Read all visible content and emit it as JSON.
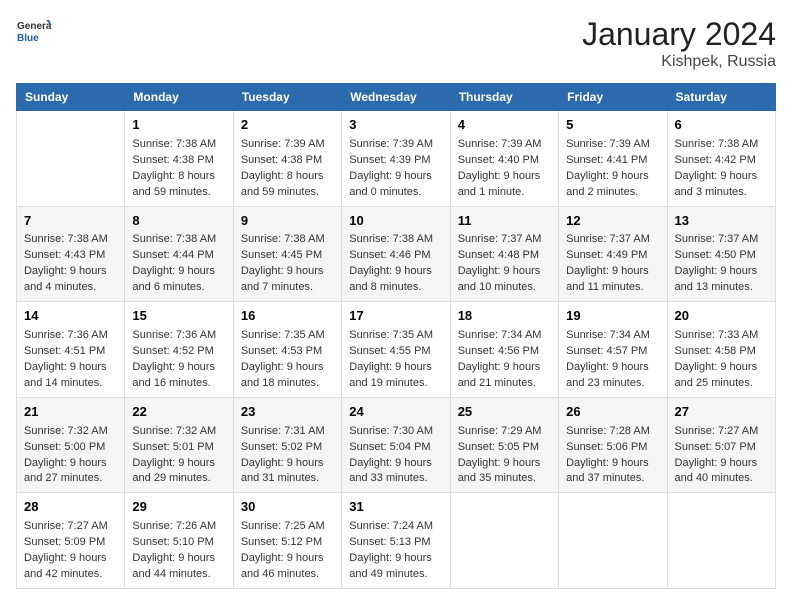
{
  "logo": {
    "general": "General",
    "blue": "Blue"
  },
  "title": "January 2024",
  "subtitle": "Kishpek, Russia",
  "days_header": [
    "Sunday",
    "Monday",
    "Tuesday",
    "Wednesday",
    "Thursday",
    "Friday",
    "Saturday"
  ],
  "weeks": [
    [
      {
        "day": "",
        "content": ""
      },
      {
        "day": "1",
        "content": "Sunrise: 7:38 AM\nSunset: 4:38 PM\nDaylight: 8 hours\nand 59 minutes."
      },
      {
        "day": "2",
        "content": "Sunrise: 7:39 AM\nSunset: 4:38 PM\nDaylight: 8 hours\nand 59 minutes."
      },
      {
        "day": "3",
        "content": "Sunrise: 7:39 AM\nSunset: 4:39 PM\nDaylight: 9 hours\nand 0 minutes."
      },
      {
        "day": "4",
        "content": "Sunrise: 7:39 AM\nSunset: 4:40 PM\nDaylight: 9 hours\nand 1 minute."
      },
      {
        "day": "5",
        "content": "Sunrise: 7:39 AM\nSunset: 4:41 PM\nDaylight: 9 hours\nand 2 minutes."
      },
      {
        "day": "6",
        "content": "Sunrise: 7:38 AM\nSunset: 4:42 PM\nDaylight: 9 hours\nand 3 minutes."
      }
    ],
    [
      {
        "day": "7",
        "content": "Sunrise: 7:38 AM\nSunset: 4:43 PM\nDaylight: 9 hours\nand 4 minutes."
      },
      {
        "day": "8",
        "content": "Sunrise: 7:38 AM\nSunset: 4:44 PM\nDaylight: 9 hours\nand 6 minutes."
      },
      {
        "day": "9",
        "content": "Sunrise: 7:38 AM\nSunset: 4:45 PM\nDaylight: 9 hours\nand 7 minutes."
      },
      {
        "day": "10",
        "content": "Sunrise: 7:38 AM\nSunset: 4:46 PM\nDaylight: 9 hours\nand 8 minutes."
      },
      {
        "day": "11",
        "content": "Sunrise: 7:37 AM\nSunset: 4:48 PM\nDaylight: 9 hours\nand 10 minutes."
      },
      {
        "day": "12",
        "content": "Sunrise: 7:37 AM\nSunset: 4:49 PM\nDaylight: 9 hours\nand 11 minutes."
      },
      {
        "day": "13",
        "content": "Sunrise: 7:37 AM\nSunset: 4:50 PM\nDaylight: 9 hours\nand 13 minutes."
      }
    ],
    [
      {
        "day": "14",
        "content": "Sunrise: 7:36 AM\nSunset: 4:51 PM\nDaylight: 9 hours\nand 14 minutes."
      },
      {
        "day": "15",
        "content": "Sunrise: 7:36 AM\nSunset: 4:52 PM\nDaylight: 9 hours\nand 16 minutes."
      },
      {
        "day": "16",
        "content": "Sunrise: 7:35 AM\nSunset: 4:53 PM\nDaylight: 9 hours\nand 18 minutes."
      },
      {
        "day": "17",
        "content": "Sunrise: 7:35 AM\nSunset: 4:55 PM\nDaylight: 9 hours\nand 19 minutes."
      },
      {
        "day": "18",
        "content": "Sunrise: 7:34 AM\nSunset: 4:56 PM\nDaylight: 9 hours\nand 21 minutes."
      },
      {
        "day": "19",
        "content": "Sunrise: 7:34 AM\nSunset: 4:57 PM\nDaylight: 9 hours\nand 23 minutes."
      },
      {
        "day": "20",
        "content": "Sunrise: 7:33 AM\nSunset: 4:58 PM\nDaylight: 9 hours\nand 25 minutes."
      }
    ],
    [
      {
        "day": "21",
        "content": "Sunrise: 7:32 AM\nSunset: 5:00 PM\nDaylight: 9 hours\nand 27 minutes."
      },
      {
        "day": "22",
        "content": "Sunrise: 7:32 AM\nSunset: 5:01 PM\nDaylight: 9 hours\nand 29 minutes."
      },
      {
        "day": "23",
        "content": "Sunrise: 7:31 AM\nSunset: 5:02 PM\nDaylight: 9 hours\nand 31 minutes."
      },
      {
        "day": "24",
        "content": "Sunrise: 7:30 AM\nSunset: 5:04 PM\nDaylight: 9 hours\nand 33 minutes."
      },
      {
        "day": "25",
        "content": "Sunrise: 7:29 AM\nSunset: 5:05 PM\nDaylight: 9 hours\nand 35 minutes."
      },
      {
        "day": "26",
        "content": "Sunrise: 7:28 AM\nSunset: 5:06 PM\nDaylight: 9 hours\nand 37 minutes."
      },
      {
        "day": "27",
        "content": "Sunrise: 7:27 AM\nSunset: 5:07 PM\nDaylight: 9 hours\nand 40 minutes."
      }
    ],
    [
      {
        "day": "28",
        "content": "Sunrise: 7:27 AM\nSunset: 5:09 PM\nDaylight: 9 hours\nand 42 minutes."
      },
      {
        "day": "29",
        "content": "Sunrise: 7:26 AM\nSunset: 5:10 PM\nDaylight: 9 hours\nand 44 minutes."
      },
      {
        "day": "30",
        "content": "Sunrise: 7:25 AM\nSunset: 5:12 PM\nDaylight: 9 hours\nand 46 minutes."
      },
      {
        "day": "31",
        "content": "Sunrise: 7:24 AM\nSunset: 5:13 PM\nDaylight: 9 hours\nand 49 minutes."
      },
      {
        "day": "",
        "content": ""
      },
      {
        "day": "",
        "content": ""
      },
      {
        "day": "",
        "content": ""
      }
    ]
  ]
}
